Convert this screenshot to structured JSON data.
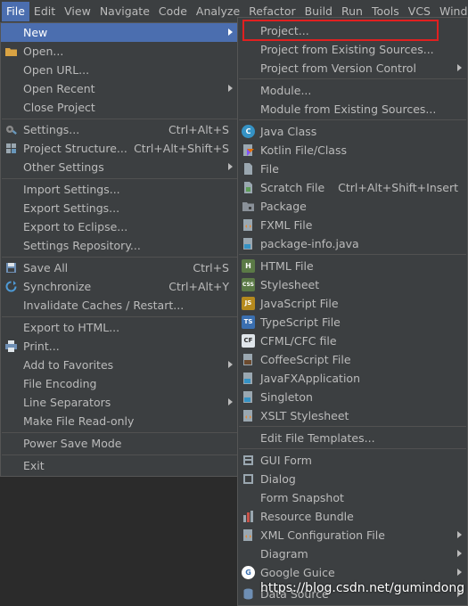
{
  "menubar": {
    "items": [
      "File",
      "Edit",
      "View",
      "Navigate",
      "Code",
      "Analyze",
      "Refactor",
      "Build",
      "Run",
      "Tools",
      "VCS",
      "Windo"
    ]
  },
  "file_menu": {
    "new": "New",
    "open": "Open...",
    "open_url": "Open URL...",
    "open_recent": "Open Recent",
    "close_project": "Close Project",
    "settings": "Settings...",
    "settings_shortcut": "Ctrl+Alt+S",
    "project_structure": "Project Structure...",
    "project_structure_shortcut": "Ctrl+Alt+Shift+S",
    "other_settings": "Other Settings",
    "import_settings": "Import Settings...",
    "export_settings": "Export Settings...",
    "export_eclipse": "Export to Eclipse...",
    "settings_repository": "Settings Repository...",
    "save_all": "Save All",
    "save_all_shortcut": "Ctrl+S",
    "synchronize": "Synchronize",
    "synchronize_shortcut": "Ctrl+Alt+Y",
    "invalidate_caches": "Invalidate Caches / Restart...",
    "export_html": "Export to HTML...",
    "print": "Print...",
    "add_favorites": "Add to Favorites",
    "file_encoding": "File Encoding",
    "line_separators": "Line Separators",
    "make_readonly": "Make File Read-only",
    "power_save": "Power Save Mode",
    "exit": "Exit"
  },
  "new_menu": {
    "project": "Project...",
    "project_existing": "Project from Existing Sources...",
    "project_vcs": "Project from Version Control",
    "module": "Module...",
    "module_existing": "Module from Existing Sources...",
    "java_class": "Java Class",
    "kotlin_file": "Kotlin File/Class",
    "file": "File",
    "scratch_file": "Scratch File",
    "scratch_shortcut": "Ctrl+Alt+Shift+Insert",
    "package": "Package",
    "fxml_file": "FXML File",
    "package_info": "package-info.java",
    "html_file": "HTML File",
    "stylesheet": "Stylesheet",
    "javascript_file": "JavaScript File",
    "typescript_file": "TypeScript File",
    "cfml_file": "CFML/CFC file",
    "coffeescript_file": "CoffeeScript File",
    "javafx_app": "JavaFXApplication",
    "singleton": "Singleton",
    "xslt_stylesheet": "XSLT Stylesheet",
    "edit_templates": "Edit File Templates...",
    "gui_form": "GUI Form",
    "dialog": "Dialog",
    "form_snapshot": "Form Snapshot",
    "resource_bundle": "Resource Bundle",
    "xml_config": "XML Configuration File",
    "diagram": "Diagram",
    "google_guice": "Google Guice",
    "data_source": "Data Source"
  },
  "watermark": "https://blog.csdn.net/gumindong",
  "colors": {
    "menu_bg": "#3c3f41",
    "selection": "#4b6eaf",
    "highlight_box": "#e02020",
    "text": "#bbbbbb"
  }
}
